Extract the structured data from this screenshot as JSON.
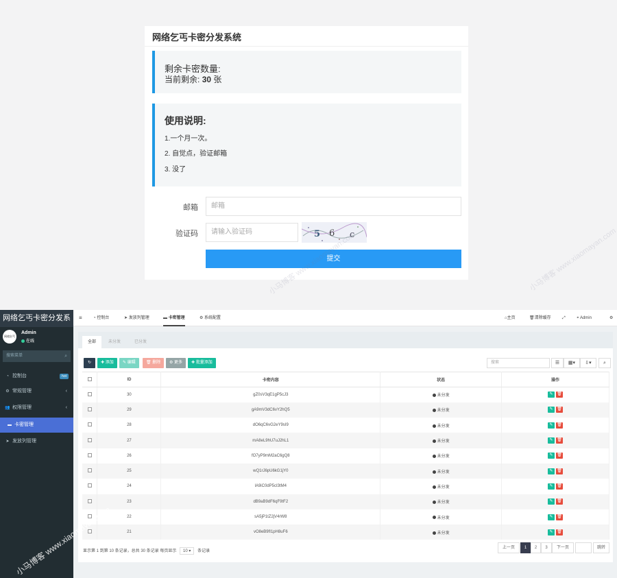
{
  "front": {
    "title": "网络乞丐卡密分发系统",
    "stock": {
      "heading": "剩余卡密数量:",
      "prefix": "当前剩余:",
      "count": "30",
      "unit": "张"
    },
    "usage": {
      "heading": "使用说明:",
      "lines": [
        "1.一个月一次。",
        "2. 自觉点，验证邮箱",
        "3. 没了"
      ]
    },
    "form": {
      "email_label": "邮箱",
      "email_placeholder": "邮箱",
      "captcha_label": "验证码",
      "captcha_placeholder": "请输入验证码",
      "captcha_chars": "5 6 c",
      "submit_label": "提交"
    }
  },
  "admin": {
    "brand": "网络乞丐卡密分发系",
    "user": {
      "name": "Admin",
      "status": "在线",
      "avatar_text": "网络乞丐"
    },
    "sidebar_search": "搜索菜单",
    "sidebar": [
      {
        "label": "控制台",
        "icon": "dashboard-icon",
        "badge": "hot"
      },
      {
        "label": "常规管理",
        "icon": "cogs-icon"
      },
      {
        "label": "权限管理",
        "icon": "users-icon"
      },
      {
        "label": "卡密管理",
        "icon": "card-icon",
        "active": true
      },
      {
        "label": "发放列管理",
        "icon": "send-icon"
      }
    ],
    "topnav": [
      "控制台",
      "发放列管理",
      "卡密管理",
      "系统配置"
    ],
    "topright": {
      "home": "主页",
      "clear": "清除缓存",
      "user": "Admin"
    },
    "tabs": [
      "全部",
      "未分发",
      "已分发"
    ],
    "toolbar": {
      "add": "添加",
      "edit": "编辑",
      "delete": "删除",
      "more": "更多",
      "batch": "批量添加",
      "search_placeholder": "搜索"
    },
    "table": {
      "headers": [
        "ID",
        "卡密内容",
        "状态",
        "操作"
      ],
      "rows": [
        {
          "id": "30",
          "code": "gZ0sV3qE1gP5cJ3",
          "status": "未分发"
        },
        {
          "id": "29",
          "code": "gA9mV3dC6vY2hQ5",
          "status": "未分发"
        },
        {
          "id": "28",
          "code": "dO6qC6vG2eY9sI9",
          "status": "未分发"
        },
        {
          "id": "27",
          "code": "mA8eL9hU7uJ2hL1",
          "status": "未分发"
        },
        {
          "id": "26",
          "code": "fO7yP9mM2aC6gQ8",
          "status": "未分发"
        },
        {
          "id": "25",
          "code": "wQ1rJ6pU6kG1jY0",
          "status": "未分发"
        },
        {
          "id": "24",
          "code": "lA9iC0dP5cI3tM4",
          "status": "未分发"
        },
        {
          "id": "23",
          "code": "dB9aB9dF6qF9tF2",
          "status": "未分发"
        },
        {
          "id": "22",
          "code": "sA5jP1tZ2jV4rW8",
          "status": "未分发"
        },
        {
          "id": "21",
          "code": "vO8eB9fI1pH8uF6",
          "status": "未分发"
        }
      ]
    },
    "footer": {
      "info": "显示第 1 到第 10 条记录，总共 30 条记录 每页显示",
      "per_page": "10",
      "suffix": "条记录"
    },
    "pagination": {
      "prev": "上一页",
      "pages": [
        "1",
        "2",
        "3"
      ],
      "next": "下一页",
      "go": "跳转"
    },
    "colors": {
      "add": "#18bc9c",
      "edit": "#7ad6c4",
      "delete": "#f5a89d",
      "more": "#95a5a6",
      "batch": "#18bc9c",
      "refresh": "#2c3e50",
      "active_menu": "#4a6fd6"
    }
  },
  "watermark": "小马博客 www.xiaomayan.com"
}
